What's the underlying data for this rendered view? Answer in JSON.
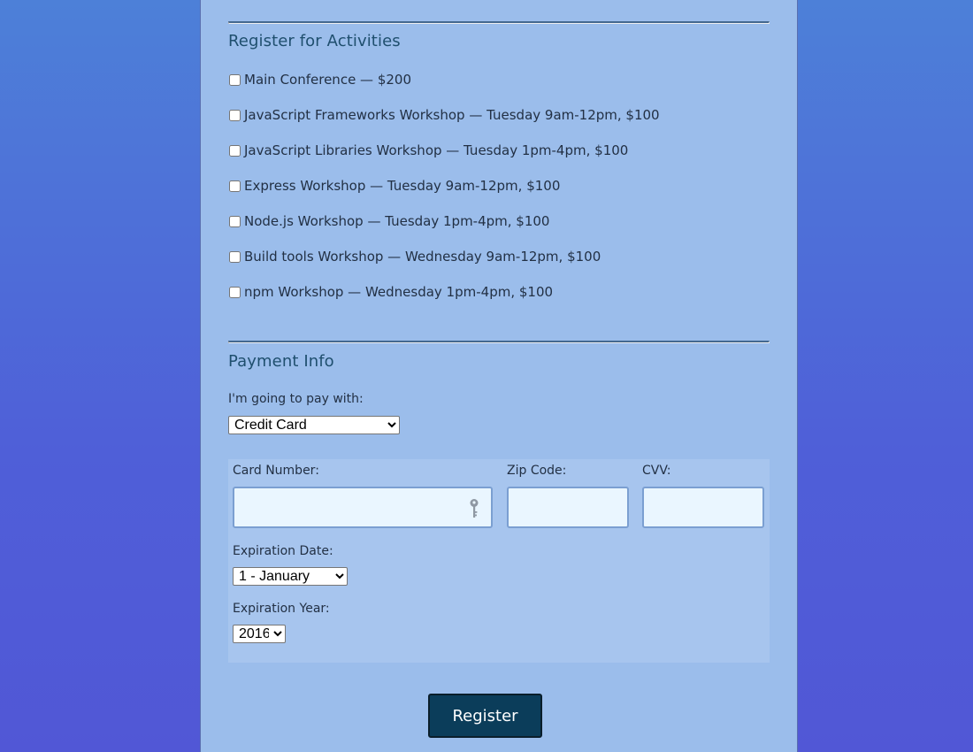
{
  "activities": {
    "heading": "Register for Activities",
    "items": [
      {
        "label": "Main Conference — $200",
        "checked": false
      },
      {
        "label": "JavaScript Frameworks Workshop — Tuesday 9am-12pm, $100",
        "checked": false
      },
      {
        "label": "JavaScript Libraries Workshop — Tuesday 1pm-4pm, $100",
        "checked": false
      },
      {
        "label": "Express Workshop — Tuesday 9am-12pm, $100",
        "checked": false
      },
      {
        "label": "Node.js Workshop — Tuesday 1pm-4pm, $100",
        "checked": false
      },
      {
        "label": "Build tools Workshop — Wednesday 9am-12pm, $100",
        "checked": false
      },
      {
        "label": "npm Workshop — Wednesday 1pm-4pm, $100",
        "checked": false
      }
    ]
  },
  "payment": {
    "heading": "Payment Info",
    "pay_label": "I'm going to pay with:",
    "pay_method": "Credit Card",
    "card_number_label": "Card Number:",
    "card_number_value": "",
    "zip_label": "Zip Code:",
    "zip_value": "",
    "cvv_label": "CVV:",
    "cvv_value": "",
    "exp_date_label": "Expiration Date:",
    "exp_date_value": "1 - January",
    "exp_year_label": "Expiration Year:",
    "exp_year_value": "2016",
    "key_icon": "key-icon"
  },
  "register_label": "Register",
  "colors": {
    "panel": "#9bbdeb",
    "heading": "#1f4f6e",
    "button": "#0b3d5a",
    "input_bg": "#eaf6ff"
  }
}
